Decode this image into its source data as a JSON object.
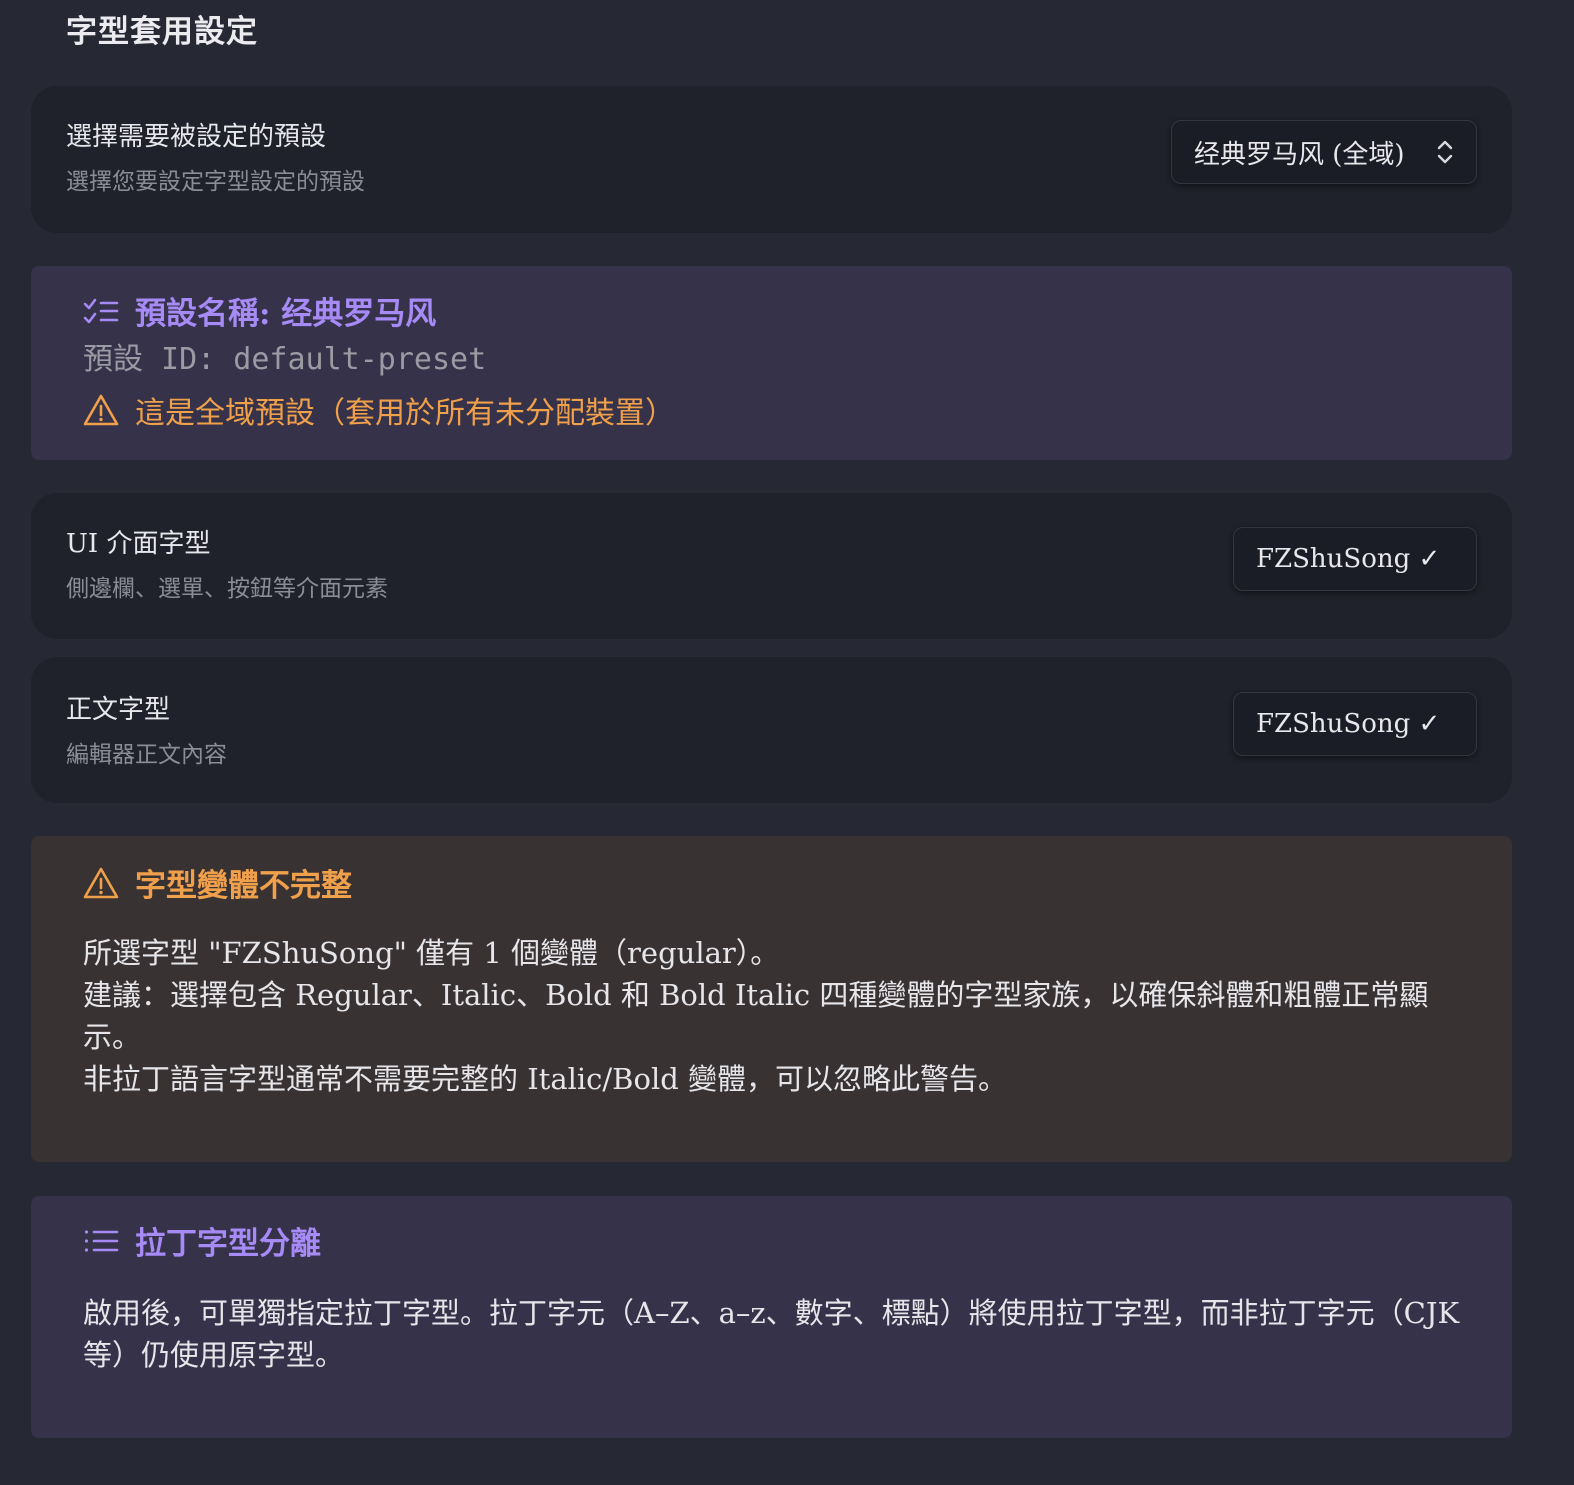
{
  "page": {
    "title": "字型套用設定"
  },
  "preset_selector": {
    "name": "選擇需要被設定的預設",
    "description": "選擇您要設定字型設定的預設",
    "selected": "经典罗马风 (全域)"
  },
  "preset_info": {
    "title": "預設名稱: 经典罗马风",
    "id_line": "預設 ID: default-preset",
    "global_note": "這是全域預設（套用於所有未分配裝置）"
  },
  "ui_font": {
    "name": "UI 介面字型",
    "description": "側邊欄、選單、按鈕等介面元素",
    "selected": "FZShuSong ✓"
  },
  "body_font": {
    "name": "正文字型",
    "description": "編輯器正文內容",
    "selected": "FZShuSong ✓"
  },
  "variant_warning": {
    "title": "字型變體不完整",
    "line1": "所選字型 \"FZShuSong\" 僅有 1 個變體（regular）。",
    "line2": "建議：選擇包含 Regular、Italic、Bold 和 Bold Italic 四種變體的字型家族，以確保斜體和粗體正常顯示。",
    "line3": "非拉丁語言字型通常不需要完整的 Italic/Bold 變體，可以忽略此警告。"
  },
  "latin_separation": {
    "title": "拉丁字型分離",
    "body": "啟用後，可單獨指定拉丁字型。拉丁字元（A–Z、a–z、數字、標點）將使用拉丁字型，而非拉丁字元（CJK等）仍使用原字型。"
  },
  "colors": {
    "background": "#262834",
    "card": "#1f212b",
    "callout_purple_bg": "#353249",
    "callout_orange_bg": "#383233",
    "accent_purple": "#a68af6",
    "accent_orange": "#f0a04b"
  },
  "icons": {
    "checklist": "checklist-icon",
    "warning": "warning-triangle-icon",
    "list": "list-icon",
    "select_chevrons": "chevron-up-down-icon"
  }
}
